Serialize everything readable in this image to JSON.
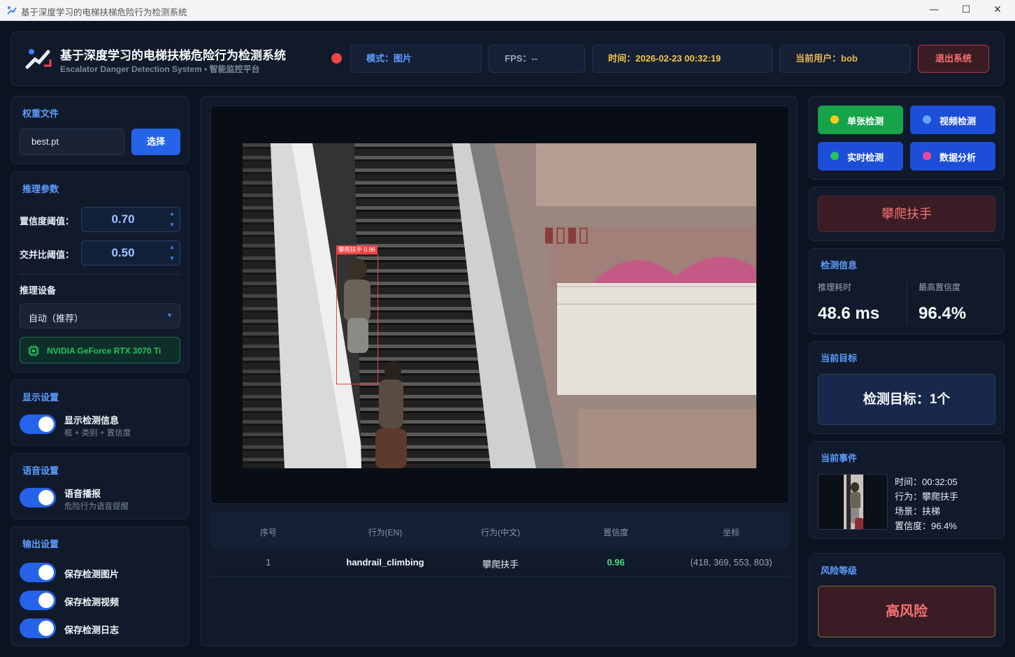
{
  "window": {
    "title": "基于深度学习的电梯扶梯危险行为检测系统"
  },
  "header": {
    "title": "基于深度学习的电梯扶梯危险行为检测系统",
    "subtitle": "Escalator Danger Detection System • 智能监控平台",
    "mode": "模式：图片",
    "fps": "FPS：--",
    "time": "时间：2026-02-23 00:32:19",
    "user": "当前用户：bob",
    "logout": "退出系统"
  },
  "weights": {
    "title": "权重文件",
    "file": "best.pt",
    "select_label": "选择"
  },
  "inference": {
    "title": "推理参数",
    "conf_label": "置信度阈值：",
    "conf_value": "0.70",
    "iou_label": "交并比阈值：",
    "iou_value": "0.50",
    "device_label": "推理设备",
    "device_value": "自动（推荐）",
    "gpu": "NVIDIA GeForce RTX 3070 Ti"
  },
  "display": {
    "title": "显示设置",
    "toggle_label": "显示检测信息",
    "toggle_sub": "框 + 类别 + 置信度",
    "on": true
  },
  "voice": {
    "title": "语音设置",
    "toggle_label": "语音播报",
    "toggle_sub": "危险行为语音提醒",
    "on": true
  },
  "output": {
    "title": "输出设置",
    "items": [
      {
        "label": "保存检测图片",
        "on": true
      },
      {
        "label": "保存检测视频",
        "on": true
      },
      {
        "label": "保存检测日志",
        "on": true
      }
    ]
  },
  "detection_box": {
    "label": "攀爬扶手 0.96"
  },
  "table": {
    "headers": [
      "序号",
      "行为(EN)",
      "行为(中文)",
      "置信度",
      "坐标"
    ],
    "rows": [
      [
        "1",
        "handrail_climbing",
        "攀爬扶手",
        "0.96",
        "(418, 369, 553, 803)"
      ]
    ]
  },
  "modes": [
    {
      "label": "单张检测",
      "bg": "#16a34a",
      "dot": "#facc15"
    },
    {
      "label": "视频检测",
      "bg": "#1d4ed8",
      "dot": "#60a5fa"
    },
    {
      "label": "实时检测",
      "bg": "#1d4ed8",
      "dot": "#22c55e"
    },
    {
      "label": "数据分析",
      "bg": "#1d4ed8",
      "dot": "#ec4899"
    }
  ],
  "alert": {
    "label": "攀爬扶手"
  },
  "info": {
    "title": "检测信息",
    "time_label": "推理耗时",
    "time_value": "48.6 ms",
    "conf_label": "最高置信度",
    "conf_value": "96.4%"
  },
  "target": {
    "title": "当前目标",
    "value": "检测目标：1个"
  },
  "event": {
    "title": "当前事件",
    "lines": [
      "时间：00:32:05",
      "行为：攀爬扶手",
      "场景：扶梯",
      "置信度：96.4%"
    ]
  },
  "risk": {
    "title": "风险等级",
    "value": "高风险"
  },
  "colors": {
    "accent": "#3b82f6",
    "danger": "#ef4444",
    "success": "#4ade80",
    "time": "#f5c542",
    "user": "#e9b84a"
  }
}
